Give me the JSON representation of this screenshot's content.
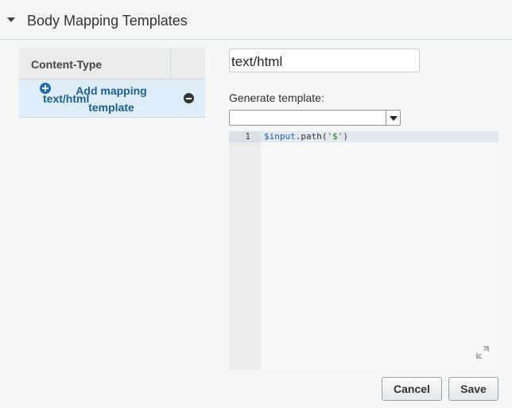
{
  "section": {
    "title": "Body Mapping Templates"
  },
  "content_types": {
    "header": "Content-Type",
    "items": [
      {
        "label": "text/html"
      }
    ],
    "add_label": "Add mapping template"
  },
  "editor": {
    "content_type_value": "text/html",
    "generate_label": "Generate template:",
    "generate_value": "",
    "line_number": "1",
    "code": {
      "var": "$input",
      "dot": ".",
      "method": "path(",
      "str": "'$'",
      "close": ")"
    }
  },
  "buttons": {
    "cancel": "Cancel",
    "save": "Save"
  }
}
